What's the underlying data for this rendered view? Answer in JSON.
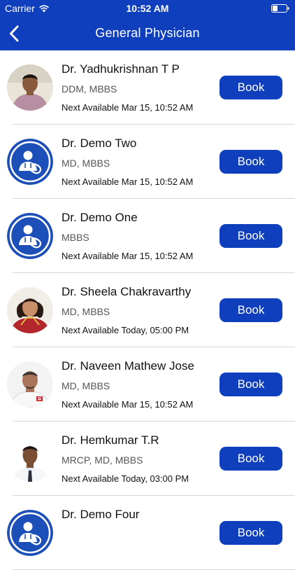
{
  "status_bar": {
    "carrier": "Carrier",
    "time": "10:52 AM"
  },
  "nav": {
    "title": "General Physician",
    "back_icon": "chevron-left-icon"
  },
  "colors": {
    "brand": "#0f3fbd",
    "divider": "#d6d6d6"
  },
  "doctors": [
    {
      "name": "Dr. Yadhukrishnan T P",
      "degree": "DDM, MBBS",
      "next_available": "Next Available Mar 15, 10:52 AM",
      "book_label": "Book",
      "avatar": "photo"
    },
    {
      "name": "Dr. Demo Two",
      "degree": "MD, MBBS",
      "next_available": "Next Available Mar 15, 10:52 AM",
      "book_label": "Book",
      "avatar": "doctor-placeholder-icon"
    },
    {
      "name": "Dr. Demo One",
      "degree": "MBBS",
      "next_available": "Next Available Mar 15, 10:52 AM",
      "book_label": "Book",
      "avatar": "doctor-placeholder-icon"
    },
    {
      "name": "Dr. Sheela Chakravarthy",
      "degree": "MD, MBBS",
      "next_available": "Next Available Today, 05:00 PM",
      "book_label": "Book",
      "avatar": "photo"
    },
    {
      "name": "Dr. Naveen Mathew Jose",
      "degree": "MD, MBBS",
      "next_available": "Next Available Mar 15, 10:52 AM",
      "book_label": "Book",
      "avatar": "photo"
    },
    {
      "name": "Dr. Hemkumar T.R",
      "degree": "MRCP, MD, MBBS",
      "next_available": "Next Available Today, 03:00 PM",
      "book_label": "Book",
      "avatar": "photo"
    },
    {
      "name": "Dr. Demo Four",
      "degree": "",
      "next_available": "",
      "book_label": "Book",
      "avatar": "doctor-placeholder-icon"
    }
  ]
}
